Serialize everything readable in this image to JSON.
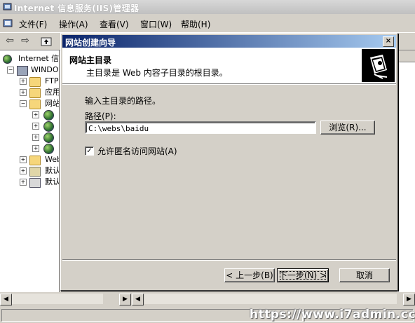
{
  "app": {
    "title": "Internet 信息服务(IIS)管理器"
  },
  "menu": {
    "items": [
      "文件(F)",
      "操作(A)",
      "查看(V)",
      "窗口(W)",
      "帮助(H)"
    ]
  },
  "tree": {
    "root": "Internet 信",
    "server": "WINDOWS",
    "folders": [
      "FTP",
      "应用",
      "网站"
    ],
    "site_children": [
      "",
      "",
      "",
      ""
    ],
    "more": [
      "Web",
      "默认",
      "默认"
    ]
  },
  "right_header": "",
  "wizard": {
    "title": "网站创建向导",
    "close": "×",
    "header_title": "网站主目录",
    "header_subtitle": "主目录是 Web 内容子目录的根目录。",
    "prompt": "输入主目录的路径。",
    "path_label": "路径(P):",
    "path_value": "C:\\webs\\baidu",
    "browse_label": "浏览(R)...",
    "anon_checked": "✓",
    "anon_label": "允许匿名访问网站(A)",
    "back_label": "< 上一步(B)",
    "next_label": "下一步(N) >",
    "cancel_label": "取消"
  },
  "watermark": "https://www.i7admin.cc"
}
